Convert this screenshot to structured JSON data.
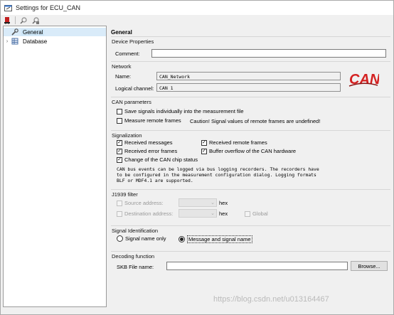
{
  "window": {
    "title": "Settings for ECU_CAN"
  },
  "toolbar": {
    "buttons": [
      {
        "name": "ecu-icon"
      },
      {
        "name": "tool-icon-1"
      },
      {
        "name": "tool-icon-2"
      }
    ]
  },
  "tree": {
    "items": [
      {
        "label": "General",
        "icon": "wrench-icon",
        "selected": true
      },
      {
        "label": "Database",
        "icon": "database-icon",
        "expander": "›"
      }
    ]
  },
  "general": {
    "title": "General",
    "device_properties": {
      "title": "Device Properties",
      "comment_label": "Comment:",
      "comment_value": ""
    },
    "network": {
      "title": "Network",
      "name_label": "Name:",
      "name_value": "CAN_Network",
      "channel_label": "Logical channel:",
      "channel_value": "CAN 1",
      "logo_text": "CAN"
    },
    "can_parameters": {
      "title": "CAN parameters",
      "save_signals": "Save signals individually into the measurement file",
      "measure_remote": "Measure remote frames",
      "caution": "Caution! Signal values of remote frames are undefined!"
    },
    "signalization": {
      "title": "Signalization",
      "received_messages": "Received messages",
      "received_remote": "Received remote frames",
      "received_error": "Received error frames",
      "buffer_overflow": "Buffer overflow of the CAN hardware",
      "chip_status": "Change of the CAN chip status",
      "info_line1": "CAN bus events can be logged via bus logging recorders. The recorders have",
      "info_line2": "to be configured in the measurement configuration dialog. Logging formats",
      "info_line3": "BLF or MDF4.1 are supported."
    },
    "j1939": {
      "title": "J1939 filter",
      "source_label": "Source address:",
      "dest_label": "Destination address:",
      "hex1": "hex",
      "hex2": "hex",
      "global": "Global"
    },
    "signal_identification": {
      "title": "Signal Identification",
      "option1": "Signal name only",
      "option2": "Message and signal name"
    },
    "decoding": {
      "title": "Decoding function",
      "skb_label": "SKB File name:",
      "skb_value": "",
      "browse": "Browse..."
    }
  },
  "watermark": "https://blog.csdn.net/u013164467",
  "colors": {
    "selection": "#cde6f7",
    "can_red": "#d42020"
  }
}
